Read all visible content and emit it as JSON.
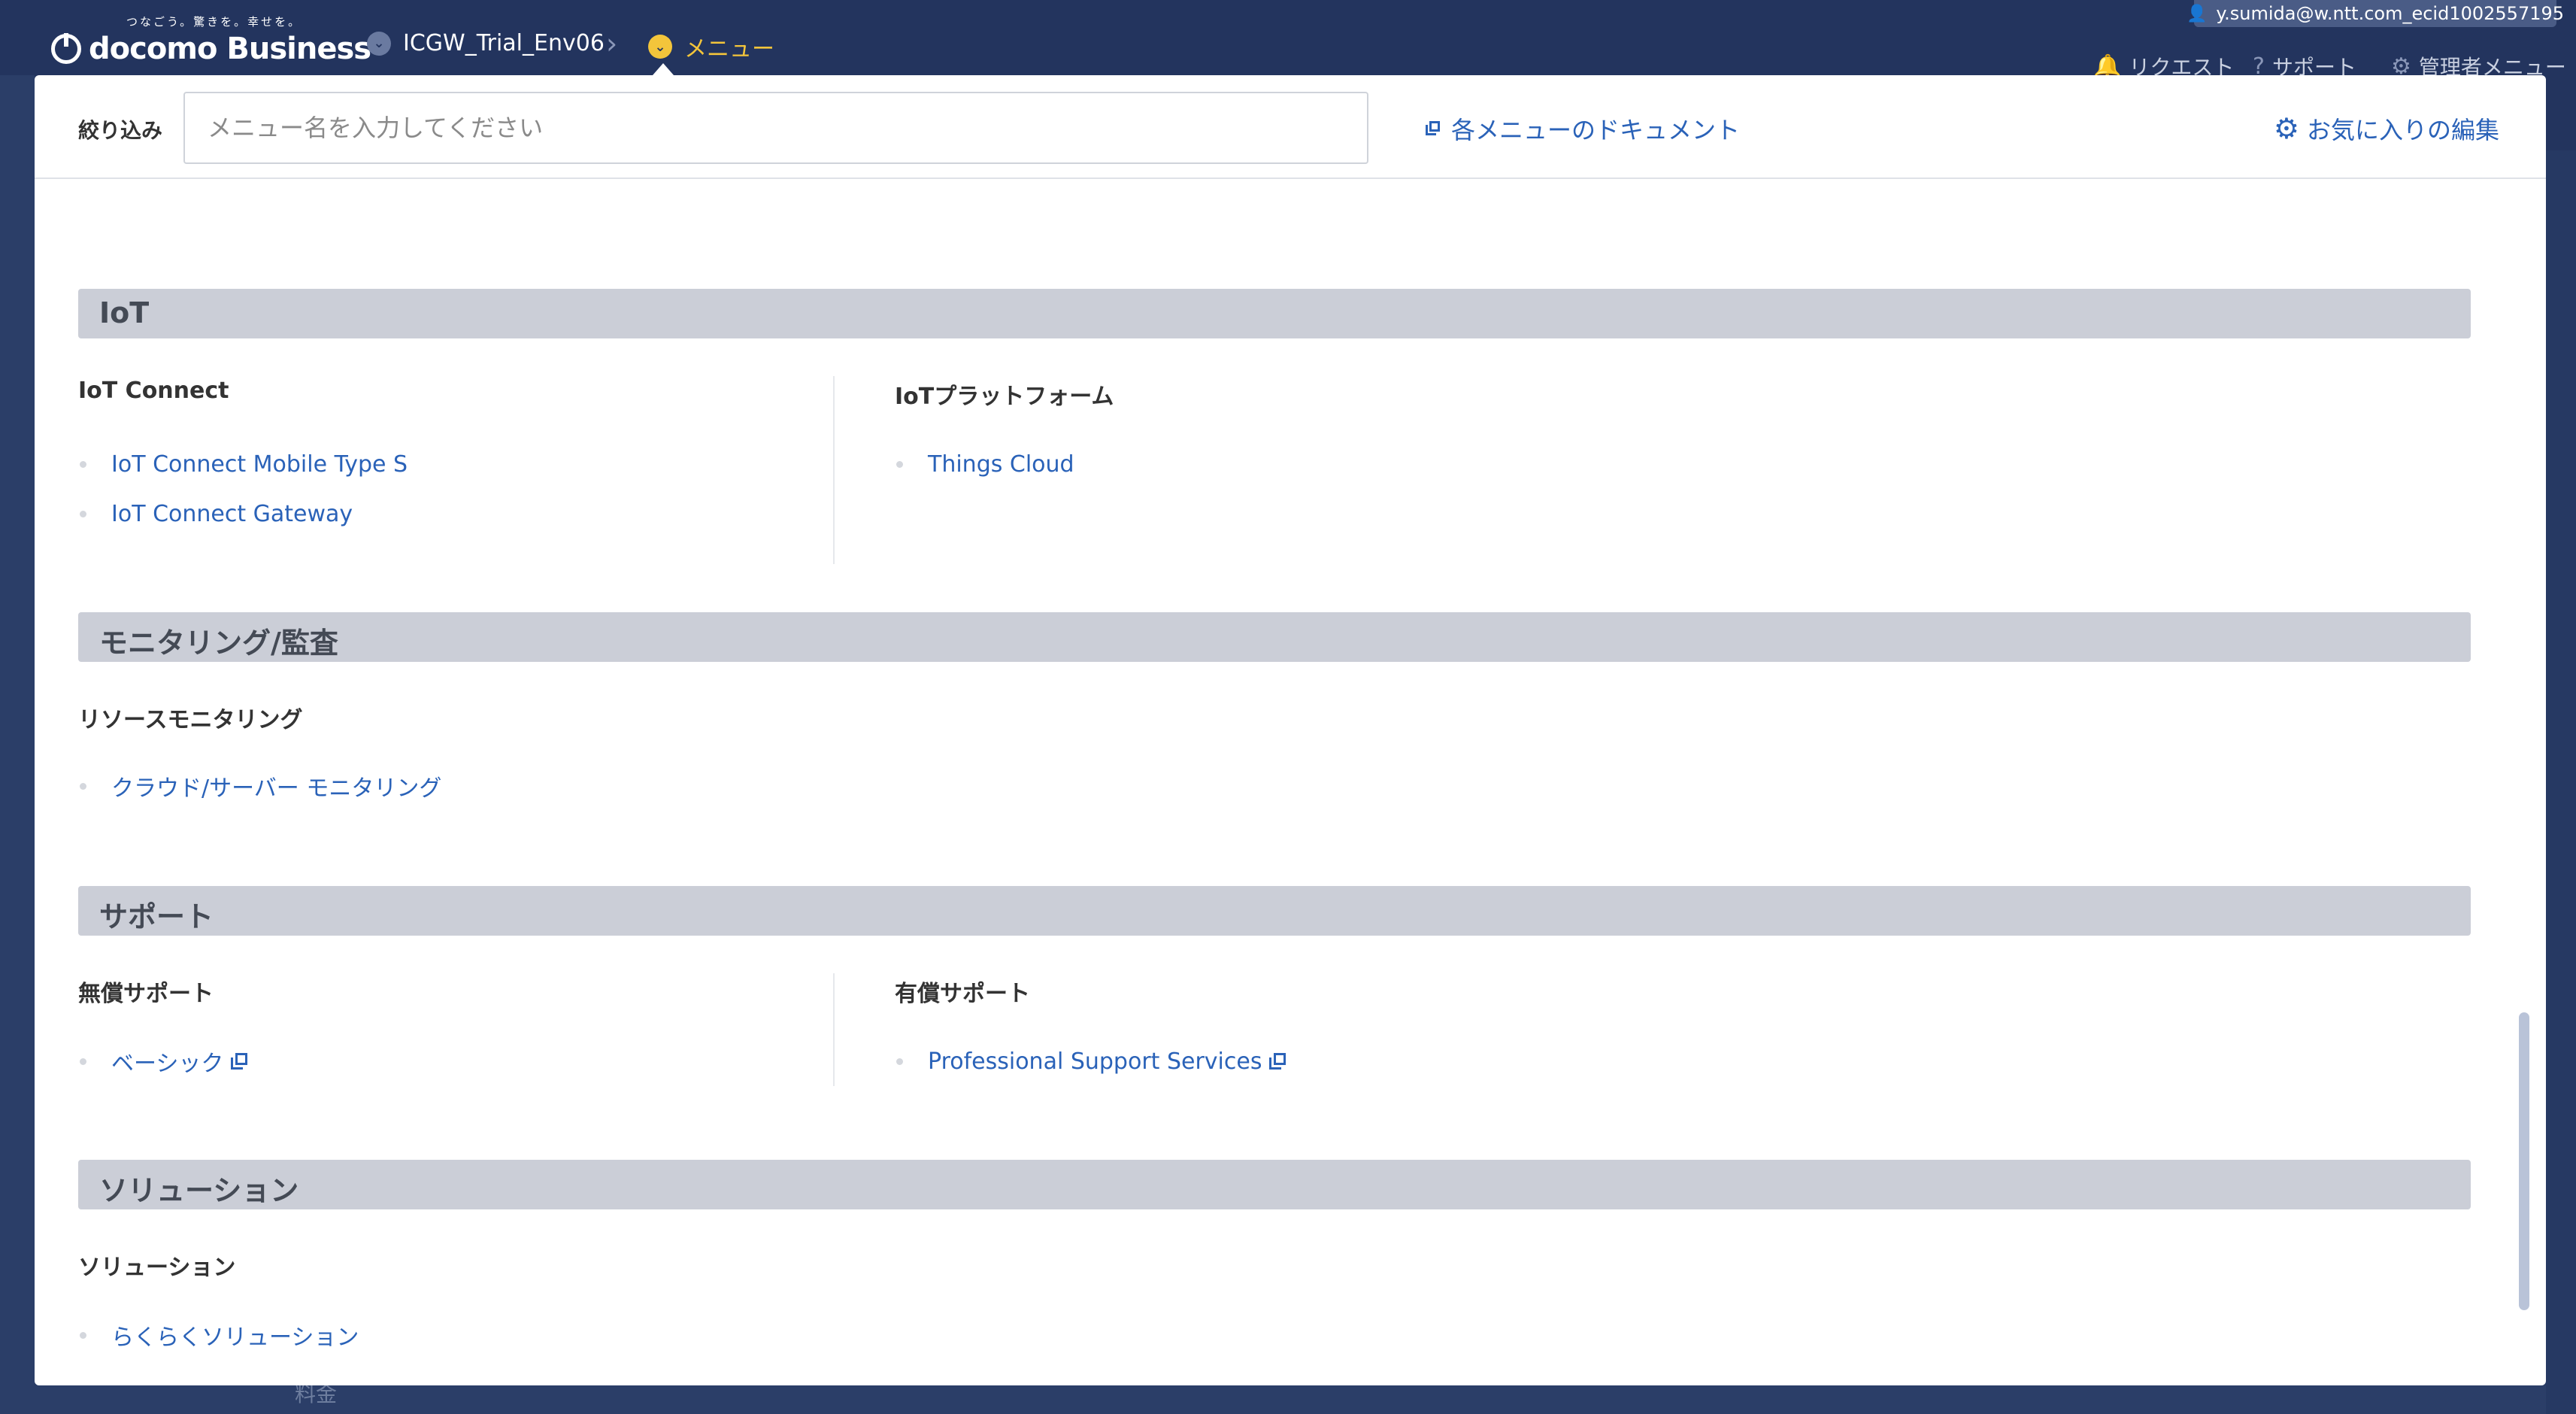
{
  "header": {
    "logo_tagline": "つなごう。驚きを。幸せを。",
    "logo_text": "docomo Business",
    "breadcrumb_env": "ICGW_Trial_Env06",
    "breadcrumb_menu": "メニュー",
    "user": "y.sumida@w.ntt.com_ecid1002557195",
    "request_label": "リクエスト",
    "support_label": "サポート",
    "admin_label": "管理者メニュー"
  },
  "background": {
    "bottom_label": "料金"
  },
  "filter": {
    "label": "絞り込み",
    "placeholder": "メニュー名を入力してください",
    "value": "",
    "doc_link": "各メニューのドキュメント",
    "fav_link": "お気に入りの編集"
  },
  "sections": {
    "iot": {
      "title": "IoT",
      "col1": {
        "title": "IoT Connect",
        "items": [
          "IoT Connect Mobile Type S",
          "IoT Connect Gateway"
        ]
      },
      "col2": {
        "title": "IoTプラットフォーム",
        "items": [
          "Things Cloud"
        ]
      }
    },
    "monitoring": {
      "title": "モニタリング/監査",
      "col1": {
        "title": "リソースモニタリング",
        "items": [
          "クラウド/サーバー モニタリング"
        ]
      }
    },
    "support": {
      "title": "サポート",
      "col1": {
        "title": "無償サポート",
        "items": [
          "ベーシック"
        ]
      },
      "col2": {
        "title": "有償サポート",
        "items": [
          "Professional Support Services"
        ]
      }
    },
    "solution": {
      "title": "ソリューション",
      "col1": {
        "title": "ソリューション",
        "items": [
          "らくらくソリューション"
        ]
      }
    }
  },
  "icons": {
    "user": "person-icon",
    "request": "bell-icon",
    "support": "help-circle-icon",
    "admin": "gear-icon",
    "doc": "external-link-icon",
    "fav": "gear-icon"
  },
  "colors": {
    "header_bg": "#23345e",
    "link": "#2a62b8",
    "menu_accent": "#f3c53b",
    "section_bar": "#cbced7"
  }
}
